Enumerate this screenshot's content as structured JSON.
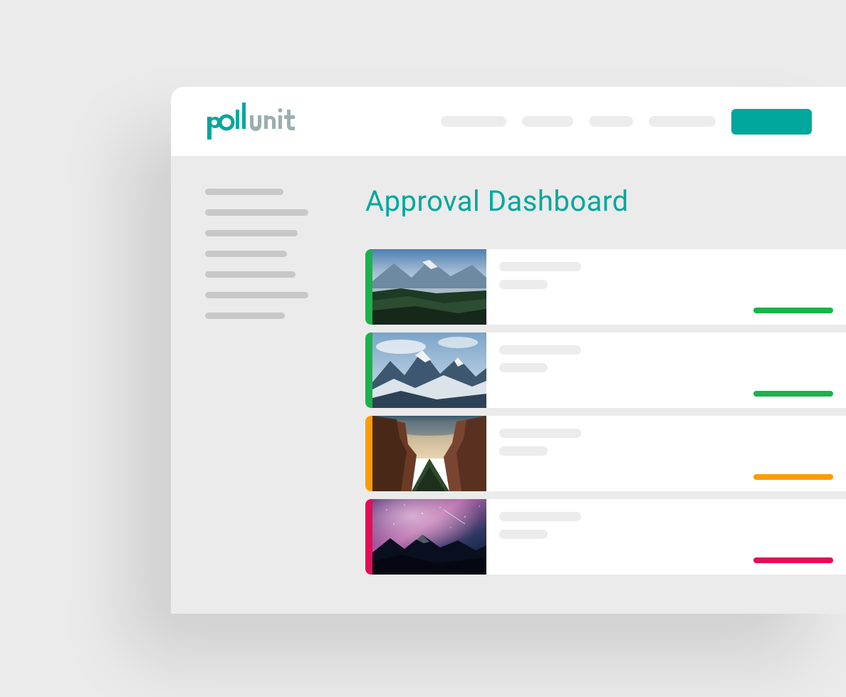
{
  "brand": {
    "name": "pollunit"
  },
  "colors": {
    "accent": "#00a79d",
    "green": "#1cb24b",
    "orange": "#f99e00",
    "pink": "#e30d55"
  },
  "page": {
    "title": "Approval Dashboard"
  },
  "cards": [
    {
      "status": "approved",
      "accent_color": "#1cb24b",
      "action_color": "#1cb24b",
      "thumb": "mountain-lake"
    },
    {
      "status": "approved",
      "accent_color": "#1cb24b",
      "action_color": "#1cb24b",
      "thumb": "snow-peaks"
    },
    {
      "status": "pending",
      "accent_color": "#f99e00",
      "action_color": "#f99e00",
      "thumb": "canyon"
    },
    {
      "status": "rejected",
      "accent_color": "#e30d55",
      "action_color": "#e30d55",
      "thumb": "night-sky"
    }
  ]
}
